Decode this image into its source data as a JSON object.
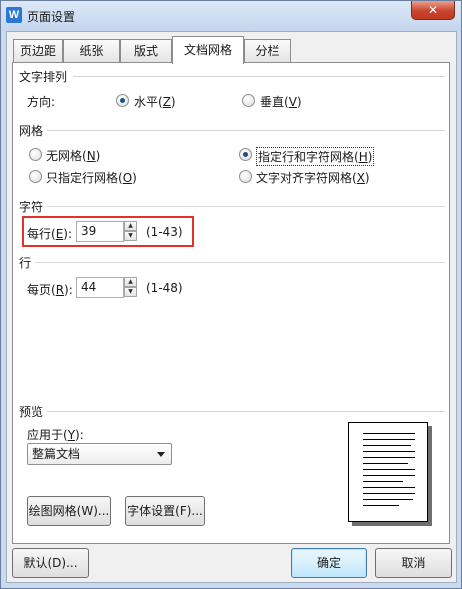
{
  "window": {
    "title": "页面设置",
    "app_icon_letter": "W",
    "close_label": "✕"
  },
  "tabs": [
    {
      "label": "页边距",
      "active": false
    },
    {
      "label": "纸张",
      "active": false
    },
    {
      "label": "版式",
      "active": false
    },
    {
      "label": "文档网格",
      "active": true
    },
    {
      "label": "分栏",
      "active": false
    }
  ],
  "text_direction": {
    "section_label": "文字排列",
    "direction_label": "方向:",
    "horizontal": {
      "text": "水平(",
      "key": "Z",
      "tail": ")",
      "selected": true
    },
    "vertical": {
      "text": "垂直(",
      "key": "V",
      "tail": ")",
      "selected": false
    }
  },
  "grid": {
    "section_label": "网格",
    "options": [
      {
        "text": "无网格(",
        "key": "N",
        "tail": ")",
        "selected": false
      },
      {
        "text": "指定行和字符网格(",
        "key": "H",
        "tail": ")",
        "selected": true
      },
      {
        "text": "只指定行网格(",
        "key": "O",
        "tail": ")",
        "selected": false
      },
      {
        "text": "文字对齐字符网格(",
        "key": "X",
        "tail": ")",
        "selected": false
      }
    ]
  },
  "chars": {
    "section_label": "字符",
    "per_line_label": "每行(",
    "per_line_key": "E",
    "per_line_tail": "):",
    "per_line_value": "39",
    "range": "(1-43)"
  },
  "lines": {
    "section_label": "行",
    "per_page_label": "每页(",
    "per_page_key": "R",
    "per_page_tail": "):",
    "per_page_value": "44",
    "range": "(1-48)"
  },
  "preview": {
    "section_label": "预览",
    "apply_to_label": "应用于(",
    "apply_to_key": "Y",
    "apply_to_tail": "):",
    "apply_to_value": "整篇文档"
  },
  "buttons": {
    "draw_grid": "绘图网格(W)...",
    "font_settings": "字体设置(F)...",
    "default": "默认(D)...",
    "ok": "确定",
    "cancel": "取消"
  },
  "colors": {
    "highlight": "#e0322b",
    "accent": "#2a78d8"
  }
}
